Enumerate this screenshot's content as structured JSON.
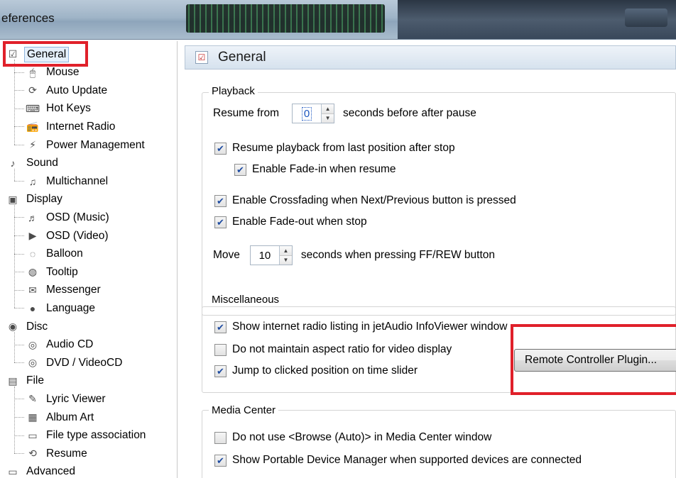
{
  "window": {
    "title": "eferences"
  },
  "tree": {
    "items": [
      {
        "label": "General",
        "icon": "general-icon",
        "selected": true
      },
      {
        "label": "Mouse",
        "icon": "mouse-icon"
      },
      {
        "label": "Auto Update",
        "icon": "auto-update-icon"
      },
      {
        "label": "Hot Keys",
        "icon": "keyboard-icon"
      },
      {
        "label": "Internet Radio",
        "icon": "radio-icon"
      },
      {
        "label": "Power Management",
        "icon": "power-icon"
      },
      {
        "label": "Sound",
        "icon": "sound-icon"
      },
      {
        "label": "Multichannel",
        "icon": "multichannel-icon"
      },
      {
        "label": "Display",
        "icon": "display-icon"
      },
      {
        "label": "OSD (Music)",
        "icon": "osd-music-icon"
      },
      {
        "label": "OSD (Video)",
        "icon": "osd-video-icon"
      },
      {
        "label": "Balloon",
        "icon": "balloon-icon"
      },
      {
        "label": "Tooltip",
        "icon": "tooltip-icon"
      },
      {
        "label": "Messenger",
        "icon": "messenger-icon"
      },
      {
        "label": "Language",
        "icon": "language-icon"
      },
      {
        "label": "Disc",
        "icon": "disc-icon"
      },
      {
        "label": "Audio CD",
        "icon": "audio-cd-icon"
      },
      {
        "label": "DVD / VideoCD",
        "icon": "dvd-icon"
      },
      {
        "label": "File",
        "icon": "file-icon"
      },
      {
        "label": "Lyric Viewer",
        "icon": "lyric-icon"
      },
      {
        "label": "Album Art",
        "icon": "album-art-icon"
      },
      {
        "label": "File type association",
        "icon": "file-assoc-icon"
      },
      {
        "label": "Resume",
        "icon": "resume-icon"
      },
      {
        "label": "Advanced",
        "icon": "advanced-icon"
      }
    ]
  },
  "panel": {
    "title": "General",
    "playback": {
      "label": "Playback",
      "resume_from_label": "Resume from",
      "resume_from_value": "0",
      "resume_from_suffix": "seconds before after pause",
      "resume_last_position": {
        "label": "Resume playback from last position after stop",
        "checked": true
      },
      "fade_in_resume": {
        "label": "Enable Fade-in when resume",
        "checked": true
      },
      "crossfading": {
        "label": "Enable Crossfading when Next/Previous button is pressed",
        "checked": true
      },
      "fade_out_stop": {
        "label": "Enable Fade-out when stop",
        "checked": true
      },
      "move_label": "Move",
      "move_value": "10",
      "move_suffix": "seconds when pressing FF/REW button"
    },
    "misc": {
      "label": "Miscellaneous",
      "show_radio_listing": {
        "label": "Show internet radio listing in jetAudio InfoViewer window",
        "checked": true
      },
      "no_aspect_ratio": {
        "label": "Do not maintain aspect ratio for video display",
        "checked": false
      },
      "jump_clicked": {
        "label": "Jump to clicked position on time slider",
        "checked": true
      },
      "remote_button": "Remote Controller Plugin..."
    },
    "media_center": {
      "label": "Media Center",
      "no_browse_auto": {
        "label": "Do not use <Browse (Auto)> in Media Center window",
        "checked": false
      },
      "show_portable": {
        "label": "Show Portable Device Manager when supported devices are connected",
        "checked": true
      }
    }
  },
  "colors": {
    "highlight": "#e0202a",
    "accent": "#1c4aa0"
  }
}
